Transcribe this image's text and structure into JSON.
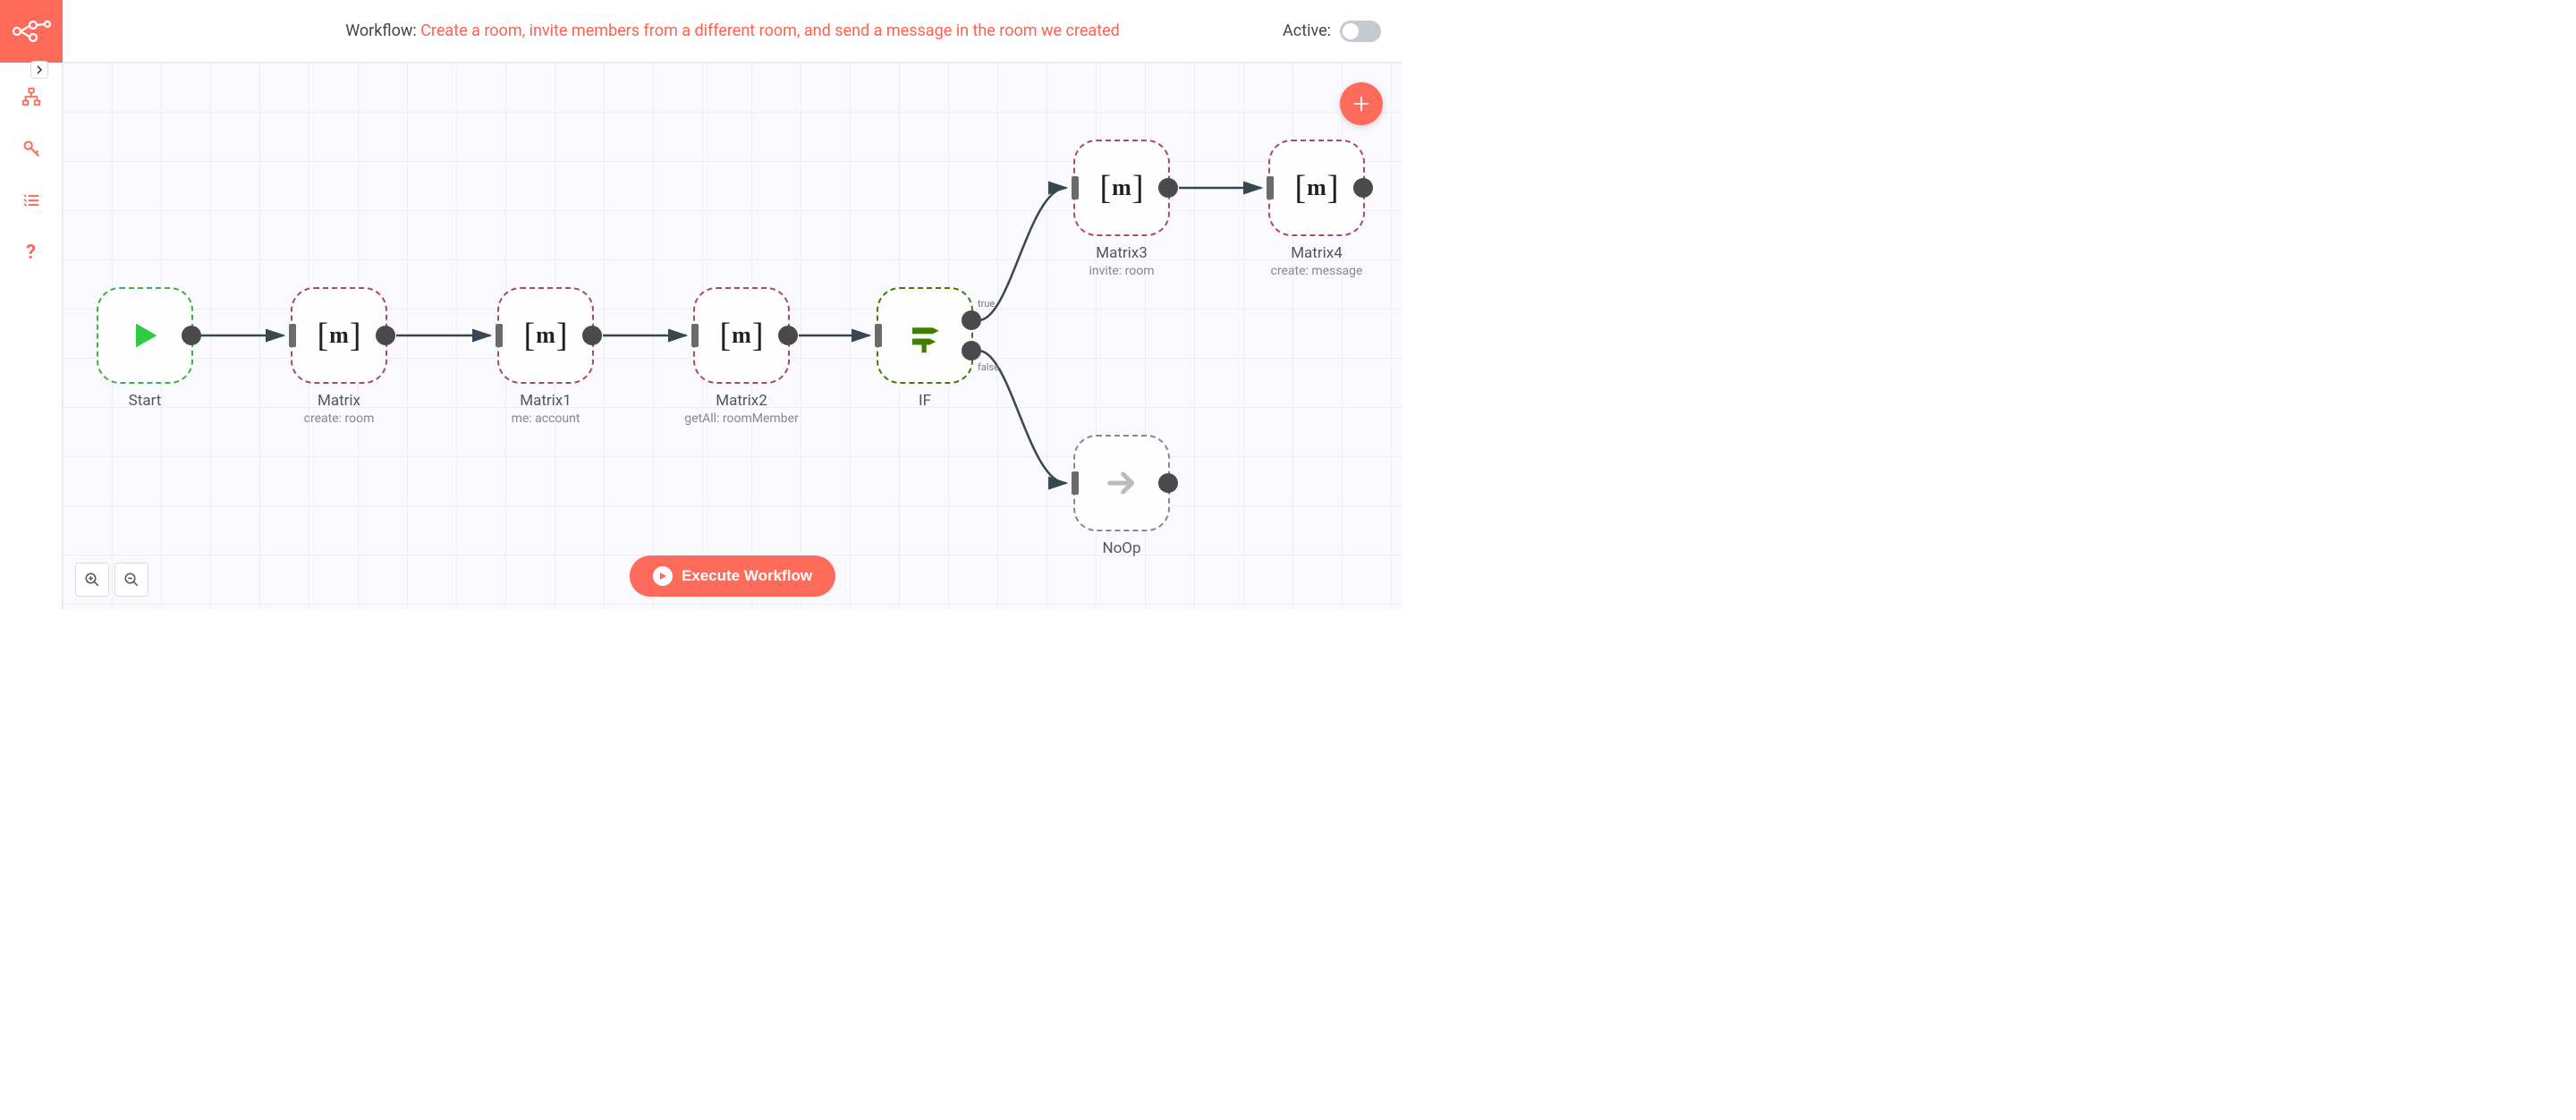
{
  "header": {
    "workflow_prefix": "Workflow: ",
    "workflow_name": "Create a room, invite members from a different room, and send a message in the room we created",
    "active_label": "Active:"
  },
  "sidebar": {
    "items": [
      {
        "name": "workflows",
        "icon": "network-icon"
      },
      {
        "name": "credentials",
        "icon": "key-icon"
      },
      {
        "name": "executions",
        "icon": "list-icon"
      },
      {
        "name": "help",
        "icon": "question-icon"
      }
    ]
  },
  "nodes": {
    "start": {
      "title": "Start",
      "subtitle": ""
    },
    "matrix": {
      "title": "Matrix",
      "subtitle": "create: room"
    },
    "matrix1": {
      "title": "Matrix1",
      "subtitle": "me: account"
    },
    "matrix2": {
      "title": "Matrix2",
      "subtitle": "getAll: roomMember"
    },
    "if": {
      "title": "IF",
      "subtitle": "",
      "out_true": "true",
      "out_false": "false"
    },
    "matrix3": {
      "title": "Matrix3",
      "subtitle": "invite: room"
    },
    "matrix4": {
      "title": "Matrix4",
      "subtitle": "create: message"
    },
    "noop": {
      "title": "NoOp",
      "subtitle": ""
    }
  },
  "buttons": {
    "execute": "Execute Workflow"
  }
}
